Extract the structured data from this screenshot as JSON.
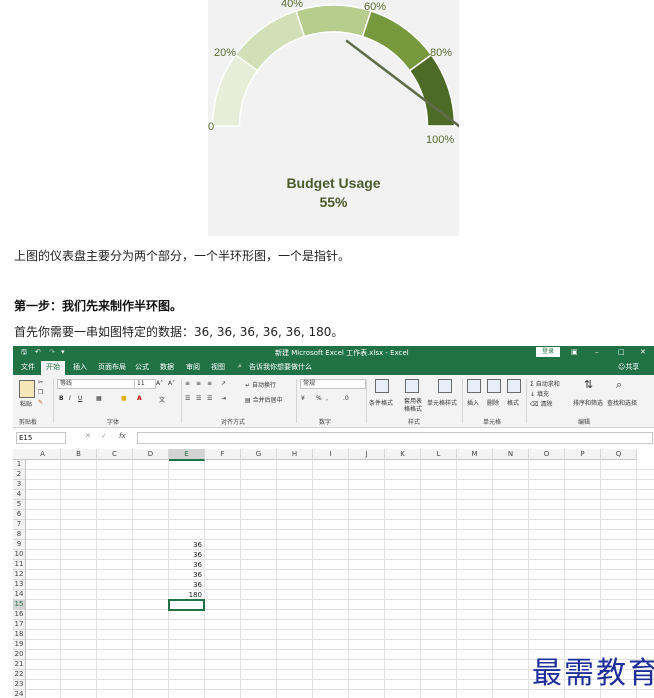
{
  "gauge": {
    "title": "Budget Usage",
    "value": "55%",
    "value_fraction": 0.55,
    "tick_labels": [
      "0",
      "20%",
      "40%",
      "60%",
      "80%",
      "100%"
    ],
    "segment_colors": [
      "#e7edd9",
      "#d3e0b7",
      "#b6cd8e",
      "#78983e",
      "#4e6a27"
    ]
  },
  "article": {
    "intro": "上图的仪表盘主要分为两个部分，一个半环形图，一个是指针。",
    "step1": "第一步：我们先来制作半环图。",
    "step1_desc": "首先你需要一串如图特定的数据：36, 36, 36, 36, 36, 180。"
  },
  "excel": {
    "title": "新建 Microsoft Excel 工作表.xlsx - Excel",
    "login": "登录",
    "share": "共享",
    "tabs": [
      "文件",
      "开始",
      "插入",
      "页面布局",
      "公式",
      "数据",
      "审阅",
      "视图"
    ],
    "search_hint": "告诉我你想要做什么",
    "ribbon": {
      "clipboard": "剪贴板",
      "paste": "粘贴",
      "font_group": "字体",
      "font_name": "等线",
      "font_size": "11",
      "align_group": "对齐方式",
      "wrap": "自动换行",
      "merge": "合并后居中",
      "number_group": "数字",
      "number_format": "常规",
      "styles_group": "样式",
      "cond_format": "条件格式",
      "table_format": "套用表格格式",
      "cell_styles": "单元格样式",
      "cells_group": "单元格",
      "insert": "插入",
      "delete": "删除",
      "format": "格式",
      "editing_group": "编辑",
      "autosum": "自动求和",
      "fill": "填充",
      "clear": "清除",
      "sort_filter": "排序和筛选",
      "find_select": "查找和选择"
    },
    "name_box": "E15",
    "fx": "fx",
    "columns": [
      "A",
      "B",
      "C",
      "D",
      "E",
      "F",
      "G",
      "H",
      "I",
      "J",
      "K",
      "L",
      "M",
      "N",
      "O",
      "P",
      "Q"
    ],
    "rows": [
      "1",
      "2",
      "3",
      "4",
      "5",
      "6",
      "7",
      "8",
      "9",
      "10",
      "11",
      "12",
      "13",
      "14",
      "15",
      "16",
      "17",
      "18",
      "19",
      "20",
      "21",
      "22",
      "23",
      "24"
    ],
    "data_column": "E",
    "data_rows": [
      "9",
      "10",
      "11",
      "12",
      "13",
      "14"
    ],
    "data_values": [
      "36",
      "36",
      "36",
      "36",
      "36",
      "180"
    ],
    "active_cell": "E15"
  },
  "watermark": "最需教育"
}
